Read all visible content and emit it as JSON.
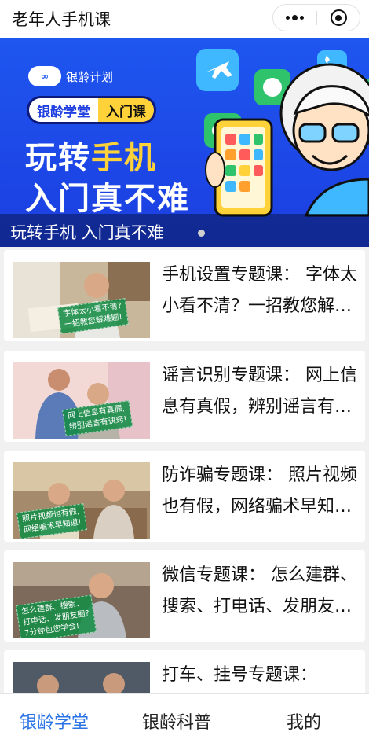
{
  "header": {
    "title": "老年人手机课"
  },
  "capsule": {
    "more_icon": "more-dots-icon",
    "close_icon": "target-close-icon"
  },
  "banner": {
    "logo_text": "银龄计划",
    "tag_primary": "银龄学堂",
    "tag_secondary": "入门课",
    "headline_1a": "玩转",
    "headline_1b": "手机",
    "headline_2": "入门真不难",
    "caption": "玩转手机 入门真不难",
    "colors": {
      "background": "#1f56f0",
      "highlight": "#ffd23a"
    }
  },
  "courses": [
    {
      "title": "手机设置专题课： 字体太小看不清？一招教您解难题！",
      "thumb_caption_1": "字体太小看不清?",
      "thumb_caption_2": "一招教您解难题!"
    },
    {
      "title": "谣言识别专题课： 网上信息有真假，辨别谣言有诀窍！",
      "thumb_caption_1": "网上信息有真假,",
      "thumb_caption_2": "辨别谣言有诀窍!"
    },
    {
      "title": "防诈骗专题课： 照片视频也有假，网络骗术早知道！",
      "thumb_caption_1": "照片视频也有假,",
      "thumb_caption_2": "网络骗术早知道!"
    },
    {
      "title": "微信专题课： 怎么建群、搜索、打电话、发朋友圈？",
      "thumb_caption_1": "怎么建群、搜索、",
      "thumb_caption_2": "打电话、发朋友圈?",
      "thumb_caption_3": "7分钟包您学会!"
    },
    {
      "title": "打车、挂号专题课："
    }
  ],
  "tabbar": {
    "tabs": [
      {
        "label": "银龄学堂",
        "active": true
      },
      {
        "label": "银龄科普",
        "active": false
      },
      {
        "label": "我的",
        "active": false
      }
    ],
    "active_color": "#2b74e6"
  }
}
